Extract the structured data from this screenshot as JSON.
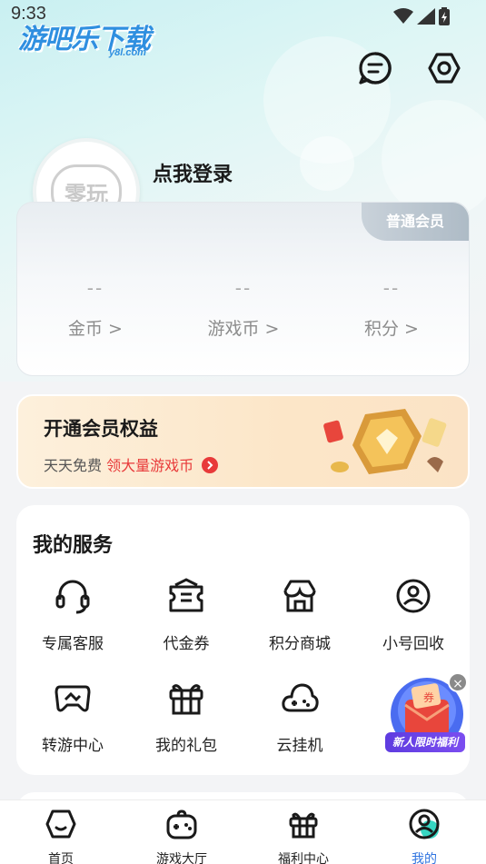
{
  "status_bar": {
    "time": "9:33"
  },
  "watermark": {
    "text": "游吧乐下载",
    "sub": "y8l.com"
  },
  "header": {
    "login_prompt": "点我登录",
    "avatar_text": "零玩"
  },
  "member_card": {
    "badge": "普通会员",
    "stats": [
      {
        "value": "--",
        "label": "金币 >"
      },
      {
        "value": "--",
        "label": "游戏币 >"
      },
      {
        "value": "--",
        "label": "积分 >"
      }
    ]
  },
  "vip_banner": {
    "title": "开通会员权益",
    "subtitle_prefix": "天天免费",
    "subtitle_highlight": "领大量游戏币"
  },
  "services": {
    "title": "我的服务",
    "items": [
      {
        "label": "专属客服",
        "icon": "headset-icon"
      },
      {
        "label": "代金券",
        "icon": "coupon-icon"
      },
      {
        "label": "积分商城",
        "icon": "store-icon"
      },
      {
        "label": "小号回收",
        "icon": "user-recycle-icon"
      },
      {
        "label": "转游中心",
        "icon": "gamepad-icon"
      },
      {
        "label": "我的礼包",
        "icon": "gift-icon"
      },
      {
        "label": "云挂机",
        "icon": "cloud-game-icon"
      }
    ],
    "promo": {
      "label": "新人限时福利",
      "close": "×",
      "coupon_mark": "券"
    }
  },
  "tabbar": {
    "tabs": [
      {
        "label": "首页",
        "icon": "home-icon",
        "active": false
      },
      {
        "label": "游戏大厅",
        "icon": "game-hall-icon",
        "active": false
      },
      {
        "label": "福利中心",
        "icon": "gift-icon",
        "active": false
      },
      {
        "label": "我的",
        "icon": "profile-icon",
        "active": true
      }
    ]
  },
  "colors": {
    "accent": "#2f74e0",
    "highlight_red": "#e83a3a",
    "badge_gray": "#aebbc6",
    "vip_bg": "#fce6c8"
  }
}
